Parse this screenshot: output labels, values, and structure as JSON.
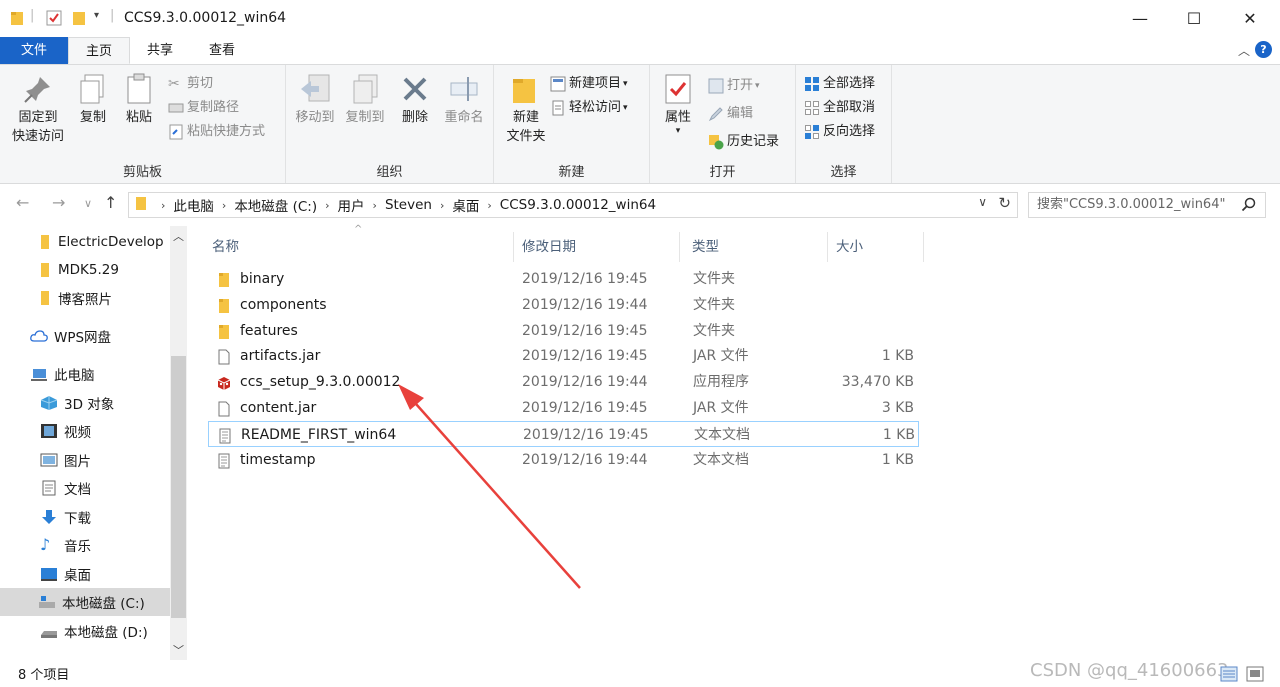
{
  "window": {
    "title": "CCS9.3.0.00012_win64",
    "minimize": "—",
    "maximize": "☐",
    "close": "✕"
  },
  "ribbon_tabs": {
    "file": "文件",
    "home": "主页",
    "share": "共享",
    "view": "查看"
  },
  "ribbon": {
    "clipboard": {
      "label": "剪贴板",
      "pin": "固定到\n快速访问",
      "pin_l1": "固定到",
      "pin_l2": "快速访问",
      "copy": "复制",
      "paste": "粘贴",
      "cut": "剪切",
      "copy_path": "复制路径",
      "paste_shortcut": "粘贴快捷方式"
    },
    "organize": {
      "label": "组织",
      "move_to": "移动到",
      "copy_to": "复制到",
      "delete": "删除",
      "rename": "重命名"
    },
    "new": {
      "label": "新建",
      "new_folder_l1": "新建",
      "new_folder_l2": "文件夹",
      "new_item": "新建项目",
      "easy_access": "轻松访问"
    },
    "open": {
      "label": "打开",
      "properties": "属性",
      "open": "打开",
      "edit": "编辑",
      "history": "历史记录"
    },
    "select": {
      "label": "选择",
      "select_all": "全部选择",
      "select_none": "全部取消",
      "invert": "反向选择"
    }
  },
  "address": {
    "crumbs": [
      "此电脑",
      "本地磁盘 (C:)",
      "用户",
      "Steven",
      "桌面",
      "CCS9.3.0.00012_win64"
    ],
    "search_placeholder": "搜索\"CCS9.3.0.00012_win64\""
  },
  "nav": {
    "items": [
      {
        "label": "ElectricDevelop",
        "icon": "folder-icon"
      },
      {
        "label": "MDK5.29",
        "icon": "folder-icon"
      },
      {
        "label": "博客照片",
        "icon": "folder-icon"
      },
      {
        "label": "WPS网盘",
        "icon": "cloud-icon"
      },
      {
        "label": "此电脑",
        "icon": "computer-icon"
      },
      {
        "label": "3D 对象",
        "icon": "cube-icon"
      },
      {
        "label": "视频",
        "icon": "video-icon"
      },
      {
        "label": "图片",
        "icon": "picture-icon"
      },
      {
        "label": "文档",
        "icon": "document-icon"
      },
      {
        "label": "下载",
        "icon": "download-icon"
      },
      {
        "label": "音乐",
        "icon": "music-icon"
      },
      {
        "label": "桌面",
        "icon": "desktop-icon"
      },
      {
        "label": "本地磁盘 (C:)",
        "icon": "drive-icon"
      },
      {
        "label": "本地磁盘 (D:)",
        "icon": "drive-icon"
      }
    ]
  },
  "columns": {
    "name": "名称",
    "date": "修改日期",
    "type": "类型",
    "size": "大小"
  },
  "files": [
    {
      "name": "binary",
      "date": "2019/12/16 19:45",
      "type": "文件夹",
      "size": "",
      "icon": "folder-icon"
    },
    {
      "name": "components",
      "date": "2019/12/16 19:44",
      "type": "文件夹",
      "size": "",
      "icon": "folder-icon"
    },
    {
      "name": "features",
      "date": "2019/12/16 19:45",
      "type": "文件夹",
      "size": "",
      "icon": "folder-icon"
    },
    {
      "name": "artifacts.jar",
      "date": "2019/12/16 19:45",
      "type": "JAR 文件",
      "size": "1 KB",
      "icon": "file-icon"
    },
    {
      "name": "ccs_setup_9.3.0.00012",
      "date": "2019/12/16 19:44",
      "type": "应用程序",
      "size": "33,470 KB",
      "icon": "installer-icon"
    },
    {
      "name": "content.jar",
      "date": "2019/12/16 19:45",
      "type": "JAR 文件",
      "size": "3 KB",
      "icon": "file-icon"
    },
    {
      "name": "README_FIRST_win64",
      "date": "2019/12/16 19:45",
      "type": "文本文档",
      "size": "1 KB",
      "icon": "text-file-icon"
    },
    {
      "name": "timestamp",
      "date": "2019/12/16 19:44",
      "type": "文本文档",
      "size": "1 KB",
      "icon": "text-file-icon"
    }
  ],
  "status": {
    "count": "8 个项目"
  },
  "watermark": "CSDN @qq_41600663",
  "colors": {
    "accent": "#1a64c8",
    "folder": "#f5c342",
    "annotation_arrow": "#e8413c",
    "selection_border": "#99d1ff"
  }
}
